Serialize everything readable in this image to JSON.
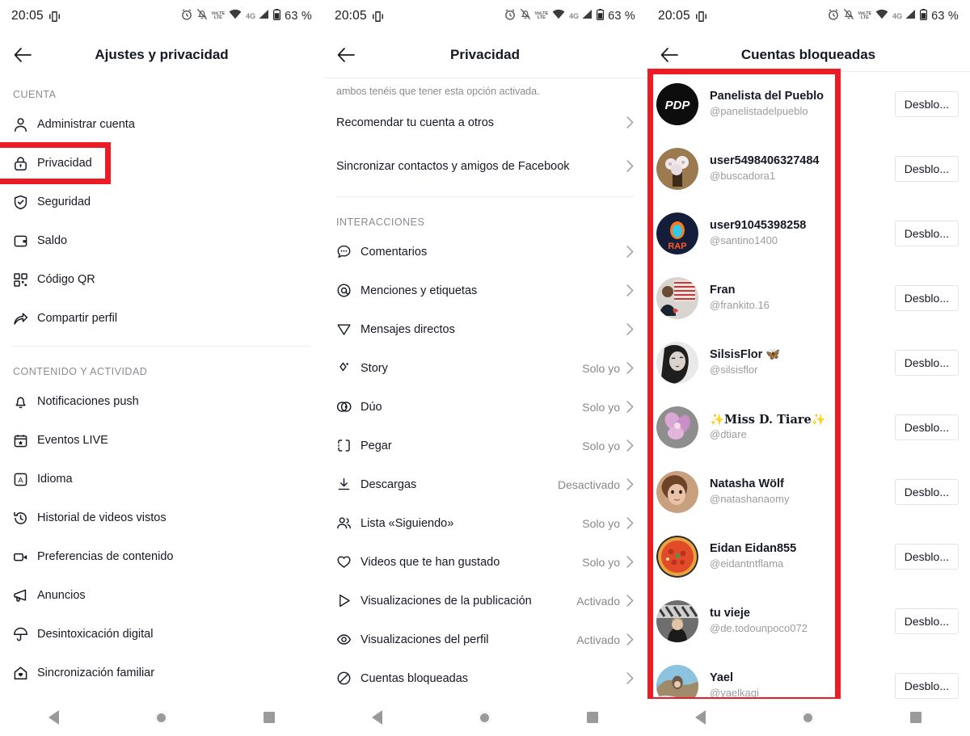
{
  "status_bar": {
    "time": "20:05",
    "battery_text": "63 %",
    "volte_label_top": "VoLTE",
    "volte_label_bottom": "LTE",
    "network": "4G",
    "icons": [
      "vibrate-icon",
      "alarm-icon",
      "notifications-muted-icon",
      "volte-icon",
      "wifi-icon",
      "signal-icon",
      "battery-icon"
    ]
  },
  "navbar": {
    "back": "back-triangle",
    "home": "home-circle",
    "recents": "recents-square"
  },
  "screen1": {
    "title": "Ajustes y privacidad",
    "sections": [
      {
        "label": "CUENTA",
        "items": [
          {
            "icon": "person-icon",
            "label": "Administrar cuenta",
            "highlighted": false
          },
          {
            "icon": "lock-icon",
            "label": "Privacidad",
            "highlighted": true
          },
          {
            "icon": "shield-check-icon",
            "label": "Seguridad",
            "highlighted": false
          },
          {
            "icon": "wallet-icon",
            "label": "Saldo",
            "highlighted": false
          },
          {
            "icon": "qr-code-icon",
            "label": "Código QR",
            "highlighted": false
          },
          {
            "icon": "share-arrow-icon",
            "label": "Compartir perfil",
            "highlighted": false
          }
        ]
      },
      {
        "label": "CONTENIDO Y ACTIVIDAD",
        "items": [
          {
            "icon": "bell-icon",
            "label": "Notificaciones push",
            "highlighted": false
          },
          {
            "icon": "calendar-star-icon",
            "label": "Eventos LIVE",
            "highlighted": false
          },
          {
            "icon": "language-icon",
            "label": "Idioma",
            "highlighted": false
          },
          {
            "icon": "history-clock-icon",
            "label": "Historial de videos vistos",
            "highlighted": false
          },
          {
            "icon": "video-camera-icon",
            "label": "Preferencias de contenido",
            "highlighted": false
          },
          {
            "icon": "megaphone-icon",
            "label": "Anuncios",
            "highlighted": false
          },
          {
            "icon": "umbrella-icon",
            "label": "Desintoxicación digital",
            "highlighted": false
          },
          {
            "icon": "family-home-icon",
            "label": "Sincronización familiar",
            "highlighted": false
          }
        ]
      }
    ]
  },
  "screen2": {
    "title": "Privacidad",
    "note": "ambos tenéis que tener esta opción activada.",
    "top_items": [
      {
        "label": "Recomendar tu cuenta a otros",
        "value": ""
      },
      {
        "label": "Sincronizar contactos y amigos de Facebook",
        "value": ""
      }
    ],
    "section_label": "INTERACCIONES",
    "items": [
      {
        "icon": "comment-icon",
        "label": "Comentarios",
        "value": ""
      },
      {
        "icon": "mention-at-icon",
        "label": "Menciones y etiquetas",
        "value": ""
      },
      {
        "icon": "direct-message-icon",
        "label": "Mensajes directos",
        "value": ""
      },
      {
        "icon": "story-sparkle-icon",
        "label": "Story",
        "value": "Solo yo"
      },
      {
        "icon": "duet-icon",
        "label": "Dúo",
        "value": "Solo yo"
      },
      {
        "icon": "stitch-icon",
        "label": "Pegar",
        "value": "Solo yo"
      },
      {
        "icon": "download-icon",
        "label": "Descargas",
        "value": "Desactivado"
      },
      {
        "icon": "following-list-icon",
        "label": "Lista «Siguiendo»",
        "value": "Solo yo"
      },
      {
        "icon": "heart-icon",
        "label": "Videos que te han gustado",
        "value": "Solo yo"
      },
      {
        "icon": "play-icon",
        "label": "Visualizaciones de la publicación",
        "value": "Activado"
      },
      {
        "icon": "eye-icon",
        "label": "Visualizaciones del perfil",
        "value": "Activado"
      },
      {
        "icon": "block-circle-icon",
        "label": "Cuentas bloqueadas",
        "value": "",
        "highlighted": true
      }
    ]
  },
  "screen3": {
    "title": "Cuentas bloqueadas",
    "unblock_label": "Desblo...",
    "accounts": [
      {
        "name": "Panelista del Pueblo",
        "handle": "@panelistadelpueblo",
        "avatar": "pdp-logo-avatar"
      },
      {
        "name": "user5498406327484",
        "handle": "@buscadora1",
        "avatar": "flower-tree-avatar"
      },
      {
        "name": "user91045398258",
        "handle": "@santino1400",
        "avatar": "rap-flame-avatar"
      },
      {
        "name": "Fran",
        "handle": "@frankito.16",
        "avatar": "person-photo-avatar"
      },
      {
        "name": "SilsisFlor 🦋",
        "handle": "@silsisflor",
        "avatar": "bw-portrait-avatar"
      },
      {
        "name": "✨Miss D. Tiare✨",
        "handle": "@dtiare",
        "avatar": "orchid-flower-avatar",
        "gothic": true
      },
      {
        "name": "Natasha Wölf",
        "handle": "@natashanaomy",
        "avatar": "child-portrait-avatar"
      },
      {
        "name": "Eidan Eidan855",
        "handle": "@eidantntflama",
        "avatar": "pizza-avatar"
      },
      {
        "name": "tu vieje",
        "handle": "@de.todounpoco072",
        "avatar": "collage-avatar"
      },
      {
        "name": "Yael",
        "handle": "@yaelkagi",
        "avatar": "beach-avatar"
      }
    ]
  },
  "colors": {
    "annotation_red": "#ed1c24",
    "text_primary": "#161823",
    "text_muted": "#8a8b91"
  }
}
